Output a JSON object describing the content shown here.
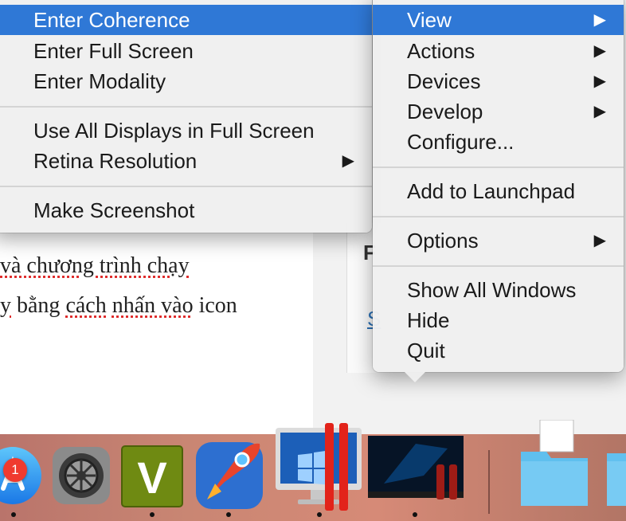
{
  "document": {
    "line1": "và chương trình chạy",
    "line2_sq1": "y",
    "line2_rest_a": " bằng ",
    "line2_sq2": "cách",
    "line2_mid": " ",
    "line2_sq3": "nhấn vào",
    "line2_end": " icon"
  },
  "side_panel": {
    "heading_letter": "F",
    "link_letter": "S"
  },
  "left_menu": {
    "items": [
      {
        "label": "Enter Coherence",
        "highlighted": true
      },
      {
        "label": "Enter Full Screen"
      },
      {
        "label": "Enter Modality"
      },
      {
        "label": "Use All Displays in Full Screen"
      },
      {
        "label": "Retina Resolution",
        "submenu": true
      },
      {
        "label": "Make Screenshot"
      }
    ]
  },
  "right_menu": {
    "items": [
      {
        "label": "View",
        "submenu": true,
        "highlighted": true
      },
      {
        "label": "Actions",
        "submenu": true
      },
      {
        "label": "Devices",
        "submenu": true
      },
      {
        "label": "Develop",
        "submenu": true
      },
      {
        "label": "Configure..."
      },
      {
        "label": "Add to Launchpad"
      },
      {
        "label": "Options",
        "submenu": true
      },
      {
        "label": "Show All Windows"
      },
      {
        "label": "Hide"
      },
      {
        "label": "Quit"
      }
    ]
  },
  "arrow_glyph": "▶",
  "dock": {
    "app_store_badge": "1",
    "vim_letter": "V",
    "icons": [
      "app-store-icon",
      "system-preferences-icon",
      "vim-icon",
      "rocket-icon",
      "parallels-windows-icon",
      "windows-10-icon",
      "folder-icon",
      "folder-icon"
    ]
  },
  "colors": {
    "highlight": "#2f78d6",
    "badge": "#f03a2f"
  }
}
